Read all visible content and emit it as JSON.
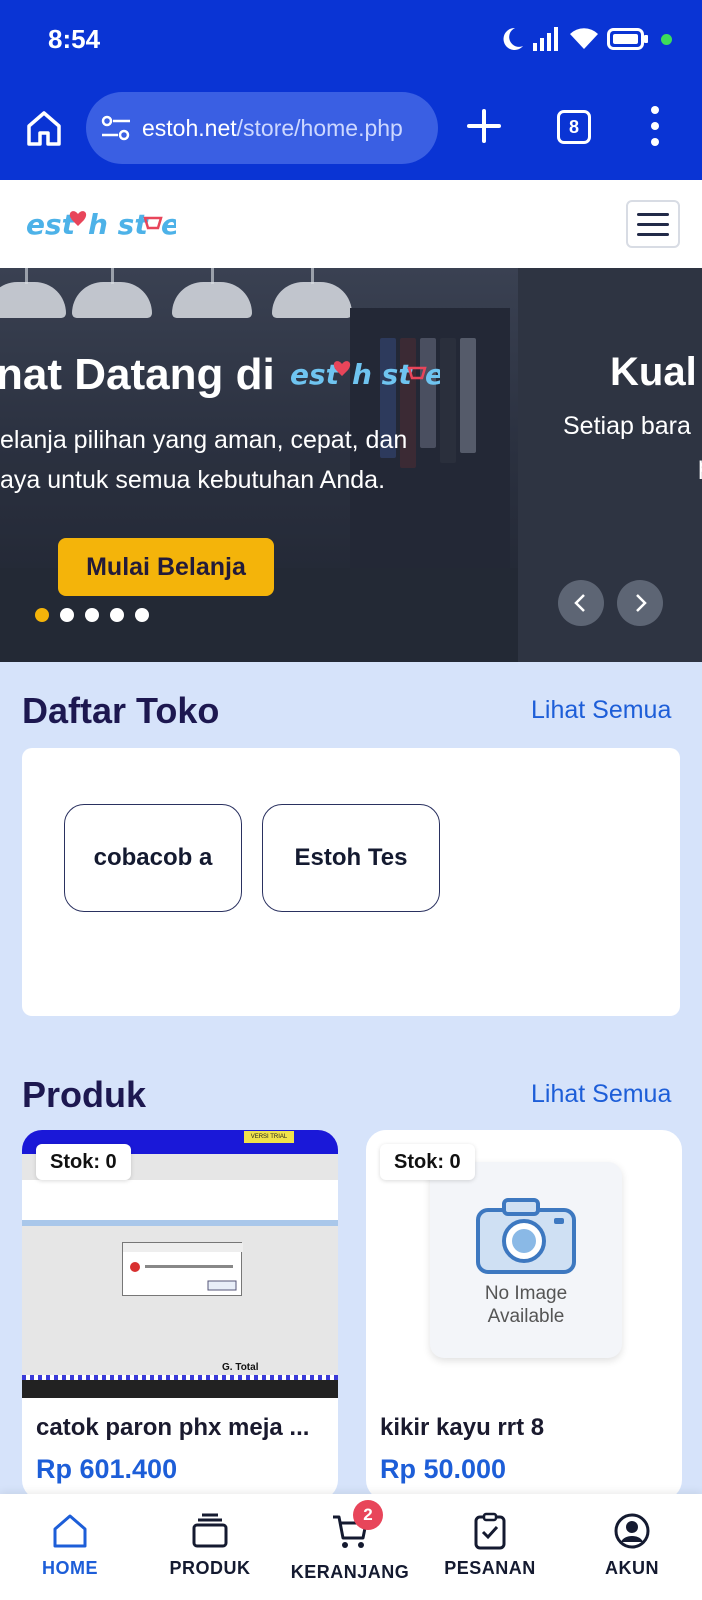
{
  "status_bar": {
    "time": "8:54"
  },
  "browser": {
    "url_host": "estoh.net",
    "url_path": "/store/home.php",
    "tab_count": "8"
  },
  "brand": {
    "logo_text": "estoh store",
    "colors": {
      "primary": "#0a34d4",
      "accent": "#f4b40a",
      "link": "#1d5ed8",
      "heading": "#1d1850",
      "page_bg": "#d6e3fa"
    }
  },
  "hero": {
    "slide1": {
      "title": "nat Datang di",
      "subtitle_line1": "elanja pilihan yang aman, cepat, dan",
      "subtitle_line2": "aya untuk semua kebutuhan Anda.",
      "cta": "Mulai Belanja"
    },
    "slide2": {
      "title": "Kual",
      "subtitle_line1": "Setiap bara",
      "subtitle_line2": "p"
    },
    "active_dot": 0,
    "dot_count": 5
  },
  "stores_section": {
    "title": "Daftar Toko",
    "see_all": "Lihat Semua",
    "stores": [
      "cobacob a",
      "Estoh Tes"
    ]
  },
  "products_section": {
    "title": "Produk",
    "see_all": "Lihat Semua",
    "products": [
      {
        "stock": "Stok: 0",
        "name": "catok paron phx meja ...",
        "price": "Rp 601.400",
        "thumb": {
          "trial_label": "VERSI TRIAL",
          "total_label": "G. Total"
        }
      },
      {
        "stock": "Stok: 0",
        "name": "kikir kayu rrt 8",
        "price": "Rp 50.000",
        "placeholder_line1": "No Image",
        "placeholder_line2": "Available"
      }
    ]
  },
  "bottom_nav": {
    "items": [
      {
        "label": "HOME",
        "icon": "home-icon",
        "active": true
      },
      {
        "label": "PRODUK",
        "icon": "box-icon",
        "active": false
      },
      {
        "label": "KERANJANG",
        "icon": "cart-icon",
        "active": false,
        "badge": "2"
      },
      {
        "label": "PESANAN",
        "icon": "clipboard-icon",
        "active": false
      },
      {
        "label": "AKUN",
        "icon": "user-icon",
        "active": false
      }
    ]
  }
}
